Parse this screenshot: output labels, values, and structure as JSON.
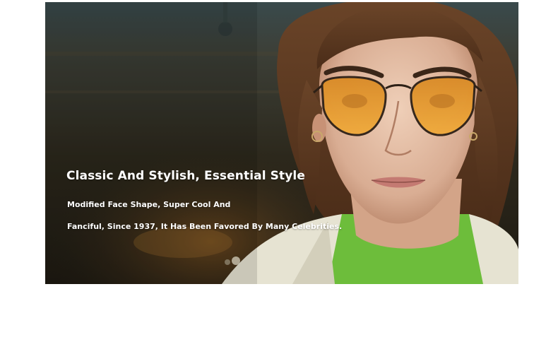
{
  "banner": {
    "headline": "Classic And Stylish, Essential Style",
    "description_lines": [
      "Modified Face Shape, Super Cool And",
      "Fanciful, Since 1937, It Has Been Favored By Many Celebrities."
    ],
    "photo": "man wearing orange-tinted aviator sunglasses",
    "colors": {
      "lens": "#e79a2a",
      "background": "#2b2a22",
      "text": "#ffffff"
    }
  }
}
